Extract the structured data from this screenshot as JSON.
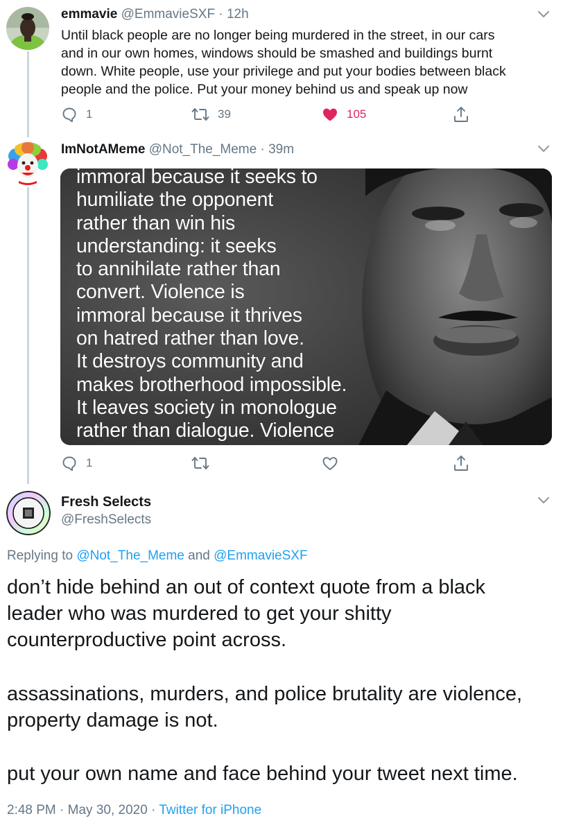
{
  "tweet1": {
    "name": "emmavie",
    "handle": "@EmmavieSXF",
    "separator": "·",
    "time": "12h",
    "text_lines": [
      "Until black people are no longer being murdered in the street, in our cars",
      "and in our own homes, windows should be smashed and buildings burnt",
      "down. White people, use your privilege and put your bodies between black",
      "people and the police. Put your money behind us and speak up now"
    ],
    "replies": "1",
    "retweets": "39",
    "likes": "105",
    "liked": true,
    "accent_like": "#e0245e"
  },
  "tweet2": {
    "name": "ImNotAMeme",
    "handle": "@Not_The_Meme",
    "separator": "·",
    "time": "39m",
    "image_quote": "immoral because it seeks to\nhumiliate the opponent\nrather than win his\nunderstanding: it seeks\nto annihilate rather than\nconvert. Violence is\nimmoral because it thrives\non hatred rather than love.\nIt destroys community and\nmakes brotherhood impossible.\nIt leaves society in monologue\nrather than dialogue. Violence",
    "replies": "1",
    "retweets": "",
    "likes": ""
  },
  "tweet3": {
    "name": "Fresh Selects",
    "handle": "@FreshSelects",
    "replying_prefix": "Replying to",
    "replying_mention1": "@Not_The_Meme",
    "replying_and": "and",
    "replying_mention2": "@EmmavieSXF",
    "paragraph1": [
      "don’t hide behind an out of context quote from a black",
      "leader who was murdered to get your shitty",
      "counterproductive point across."
    ],
    "paragraph2": [
      "assassinations, murders, and police brutality are violence,",
      "property damage is not."
    ],
    "paragraph3": [
      "put your own name and face behind your tweet next time."
    ],
    "time": "2:48 PM",
    "separator": "·",
    "date": "May 30, 2020",
    "separator2": "·",
    "source": "Twitter for iPhone"
  },
  "colors": {
    "secondary_text": "#657786",
    "link": "#1da1f2",
    "thread_line": "#ccd6dd"
  },
  "icons": [
    "reply-icon",
    "retweet-icon",
    "like-icon",
    "share-icon",
    "chevron-down-icon"
  ]
}
